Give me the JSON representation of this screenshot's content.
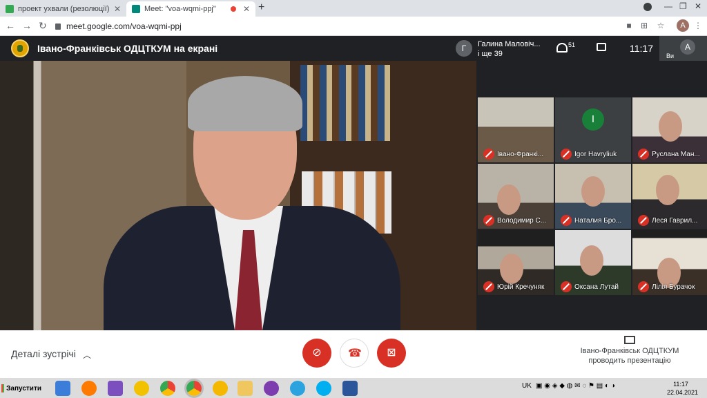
{
  "tabs": [
    {
      "title": "проект ухвали (резолюції) конф",
      "active": false
    },
    {
      "title": "Meet: \"voa-wqmi-ppj\"",
      "active": true,
      "recording": true
    }
  ],
  "address": {
    "url": "meet.google.com/voa-wqmi-ppj"
  },
  "profile_initial": "A",
  "meeting": {
    "presenter_title": "Івано-Франківськ ОДЦТКУМ на екрані",
    "participant_initial": "Г",
    "participant_name": "Галина Маловіч...",
    "participant_more": "і ще 39",
    "people_count": "51",
    "time": "11:17",
    "self_label": "Ви",
    "self_initial": "A"
  },
  "tiles": [
    {
      "name": "Івано-Франкі..."
    },
    {
      "name": "Igor Havryliuk",
      "initial": "I"
    },
    {
      "name": "Руслана Ман..."
    },
    {
      "name": "Володимир С..."
    },
    {
      "name": "Наталия Бро..."
    },
    {
      "name": "Леся Гаврил..."
    },
    {
      "name": "Юрій Кречуняк"
    },
    {
      "name": "Оксана Лутай"
    },
    {
      "name": "Лілія Бурачок"
    }
  ],
  "bottom": {
    "details_label": "Деталі зустрічі",
    "present_line1": "Івано-Франківськ ОДЦТКУМ",
    "present_line2": "проводить презентацію"
  },
  "taskbar": {
    "start_label": "Запустити",
    "lang": "UK",
    "time": "11:17",
    "date": "22.04.2021"
  },
  "colors": {
    "mute_red": "#d93025",
    "dark_bg": "#202124"
  }
}
